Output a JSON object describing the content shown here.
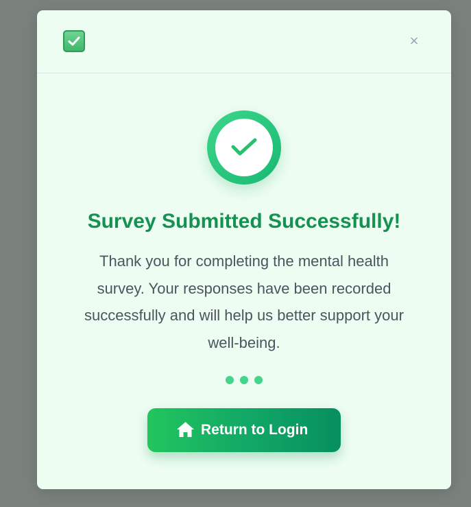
{
  "modal": {
    "close_label": "×",
    "title": "Survey Submitted Successfully!",
    "message": "Thank you for completing the mental health survey. Your responses have been recorded successfully and will help us better support your well-being.",
    "return_button_label": "Return to Login"
  },
  "icons": {
    "header": "check-box-icon",
    "success": "check-icon",
    "button": "home-icon",
    "close": "close-icon"
  },
  "colors": {
    "backdrop": "#7a807c",
    "modal_background": "#edfdf2",
    "title": "#159152",
    "message": "#4a5560",
    "accent": "#22c55e",
    "accent_dark": "#078f5f",
    "dots": "#44d48c"
  }
}
